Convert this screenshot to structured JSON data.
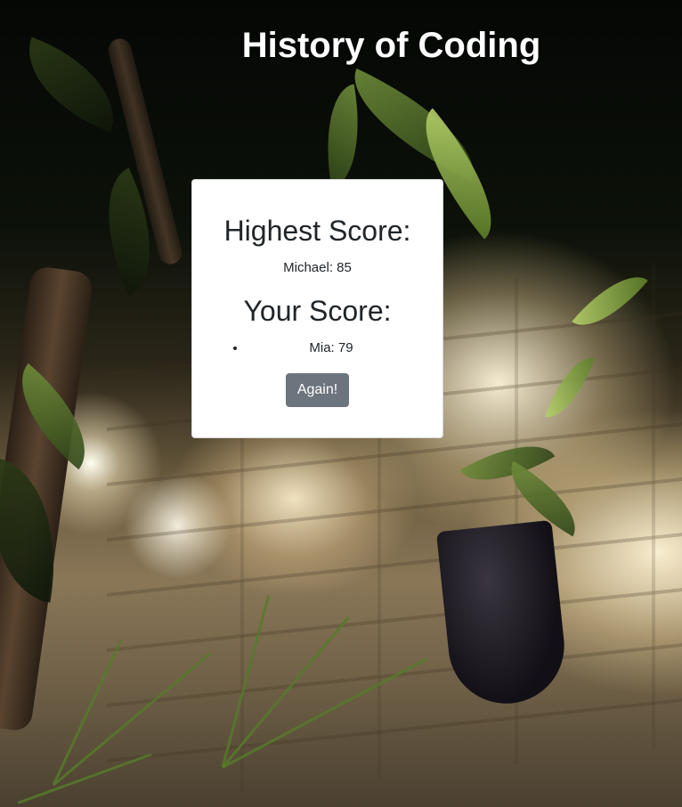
{
  "page": {
    "title": "History of Coding"
  },
  "scoreboard": {
    "highest_heading": "Highest Score:",
    "highest_entry": "Michael: 85",
    "your_heading": "Your Score:",
    "your_entries": [
      "Mia: 79"
    ],
    "again_label": "Again!"
  },
  "colors": {
    "title_text": "#ffffff",
    "card_background": "#ffffff",
    "body_text": "#212529",
    "button_background": "#6c757d",
    "button_text": "#ffffff"
  },
  "background": {
    "description_icon": "garden-photo-background"
  }
}
